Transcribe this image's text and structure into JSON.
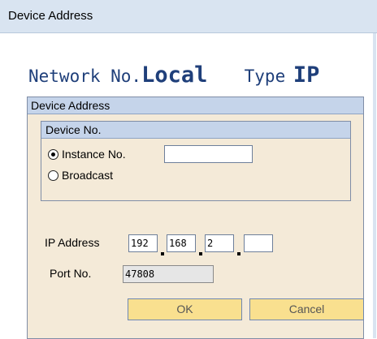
{
  "window": {
    "title": "Device Address"
  },
  "header": {
    "network_label": "Network No.",
    "network_value": "Local",
    "type_label": "Type",
    "type_value": "IP"
  },
  "device_address": {
    "title": "Device Address",
    "device_no": {
      "title": "Device No.",
      "options": [
        {
          "label": "Instance No.",
          "selected": true
        },
        {
          "label": "Broadcast",
          "selected": false
        }
      ],
      "instance_value": ""
    },
    "ip": {
      "label": "IP Address",
      "octets": [
        "192",
        "168",
        "2",
        ""
      ]
    },
    "port": {
      "label": "Port No.",
      "value": "47808"
    }
  },
  "buttons": {
    "ok": "OK",
    "cancel": "Cancel"
  }
}
